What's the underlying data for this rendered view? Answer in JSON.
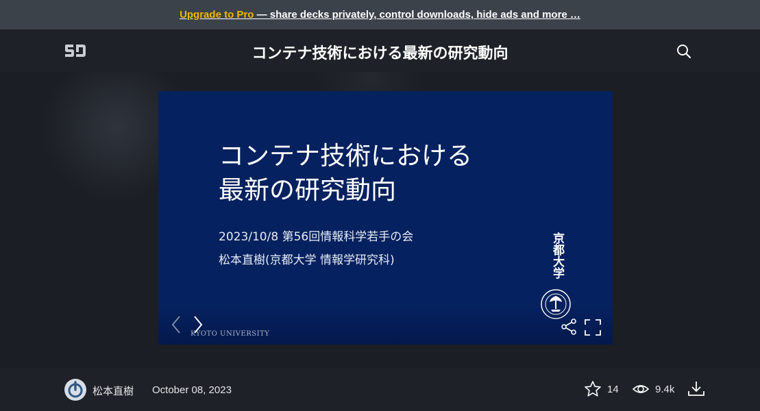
{
  "promo": {
    "link_label": "Upgrade to Pro",
    "text": " — share decks privately, control downloads, hide ads and more …"
  },
  "header": {
    "logo_text": "SD",
    "title": "コンテナ技術における最新の研究動向",
    "search_icon": "search-icon"
  },
  "slide": {
    "title_lines": [
      "コンテナ技術における",
      "最新の研究動向"
    ],
    "subtitle_lines": [
      "2023/10/8 第56回情報科学若手の会",
      "松本直樹(京都大学 情報学研究科)"
    ],
    "university_vertical": "京都大学",
    "university_en": "KYOTO UNIVERSITY",
    "background_color": "#05215f"
  },
  "controls": {
    "prev_icon": "chevron-left-icon",
    "next_icon": "chevron-right-icon",
    "share_icon": "share-icon",
    "fullscreen_icon": "fullscreen-icon"
  },
  "footer": {
    "author": "松本直樹",
    "date": "October 08, 2023",
    "stars": "14",
    "views": "9.4k",
    "download_icon": "download-icon"
  },
  "colors": {
    "promo_bg": "#3c4249",
    "accent": "#f2b705",
    "page_bg": "#1e2127"
  }
}
